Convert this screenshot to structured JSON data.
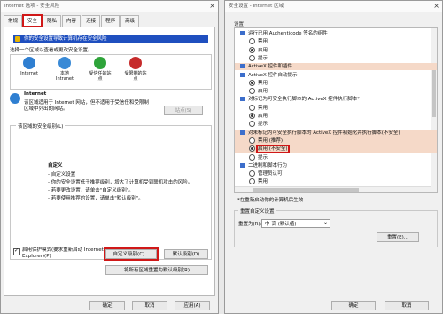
{
  "left": {
    "title": "Internet 选项 - 安全风险",
    "close": "×",
    "tabs": [
      "常规",
      "安全",
      "隐私",
      "内容",
      "连接",
      "程序",
      "高级"
    ],
    "active_tab": "安全",
    "banner": "你的安全设置导致计算机存在安全风险",
    "zone_prompt": "选择一个区域以查看或更改安全设置。",
    "zones": [
      {
        "label": "Internet",
        "icon": "globe-icon",
        "color": "#2f7fd1"
      },
      {
        "label": "本地\nIntranet",
        "icon": "intranet-icon",
        "color": "#3a8ad6"
      },
      {
        "label": "受信任的站\n点",
        "icon": "check-icon",
        "color": "#2ea43a"
      },
      {
        "label": "受限制的站\n点",
        "icon": "blocked-icon",
        "color": "#c62b2b"
      }
    ],
    "zone_title": "Internet",
    "zone_desc": "该区域适用于 Internet 网站，但不适用于受信任和受限制区域中列出的网站。",
    "sites_button": "站点(S)",
    "level_legend": "该区域的安全级别(L)",
    "custom_title": "自定义",
    "custom_lines": [
      "- 自定义设置",
      "- 你的安全设置低于推荐级别，增大了计算机受到联机攻击的风险。",
      "- 若要更改设置，请单击\"自定义级别\"。",
      "- 若要使用推荐的设置，请单击\"默认级别\"。"
    ],
    "protected_mode": "启用保护模式(要求重新启动 Internet Explorer)(P)",
    "custom_button": "自定义级别(C)...",
    "default_button": "默认级别(D)",
    "reset_all_button": "将所有区域重置为默认级别(R)",
    "ok": "确定",
    "cancel": "取消",
    "apply": "应用(A)"
  },
  "right": {
    "title": "安全设置 - Internet 区域",
    "close": "×",
    "settings_label": "设置",
    "rows": [
      {
        "text": "运行已用 Authenticode 签名的组件",
        "kind": "folder",
        "sec": false
      },
      {
        "text": "禁用",
        "kind": "radio",
        "on": false,
        "sec": false
      },
      {
        "text": "启用",
        "kind": "radio",
        "on": true,
        "sec": false
      },
      {
        "text": "提示",
        "kind": "radio",
        "on": false,
        "sec": false
      },
      {
        "text": "ActiveX 控件和插件",
        "kind": "folder",
        "sec": true
      },
      {
        "text": "ActiveX 控件自动提示",
        "kind": "folder",
        "sec": false
      },
      {
        "text": "禁用",
        "kind": "radio",
        "on": true,
        "sec": false
      },
      {
        "text": "启用",
        "kind": "radio",
        "on": false,
        "sec": false
      },
      {
        "text": "对标记为可安全执行脚本的 ActiveX 控件执行脚本*",
        "kind": "folder",
        "sec": false
      },
      {
        "text": "禁用",
        "kind": "radio",
        "on": false,
        "sec": false
      },
      {
        "text": "启用",
        "kind": "radio",
        "on": true,
        "sec": false
      },
      {
        "text": "提示",
        "kind": "radio",
        "on": false,
        "sec": false
      },
      {
        "text": "对未标记为可安全执行脚本的 ActiveX 控件初始化并执行脚本(不安全)",
        "kind": "folder",
        "sec": true
      },
      {
        "text": "禁用 (推荐)",
        "kind": "radio",
        "on": false,
        "sec": true
      },
      {
        "text": "启用 (不安全)",
        "kind": "radio",
        "on": true,
        "sec": true,
        "highlight": true
      },
      {
        "text": "提示",
        "kind": "radio",
        "on": false,
        "sec": false
      },
      {
        "text": "二进制和脚本行为",
        "kind": "folder",
        "sec": false
      },
      {
        "text": "管理员认可",
        "kind": "radio",
        "on": false,
        "sec": false
      },
      {
        "text": "禁用",
        "kind": "radio",
        "on": false,
        "sec": false
      }
    ],
    "note": "*在重新启动你的计算机后生效",
    "reset_legend": "重置自定义设置",
    "reset_label": "重置为(R):",
    "reset_value": "中-高 (默认值)",
    "reset_button": "重置(E)...",
    "ok": "确定",
    "cancel": "取消"
  },
  "colors": {
    "highlight": "#d01818",
    "section_bg": "#f5d9c8",
    "banner_bg": "#1f4fbf"
  }
}
